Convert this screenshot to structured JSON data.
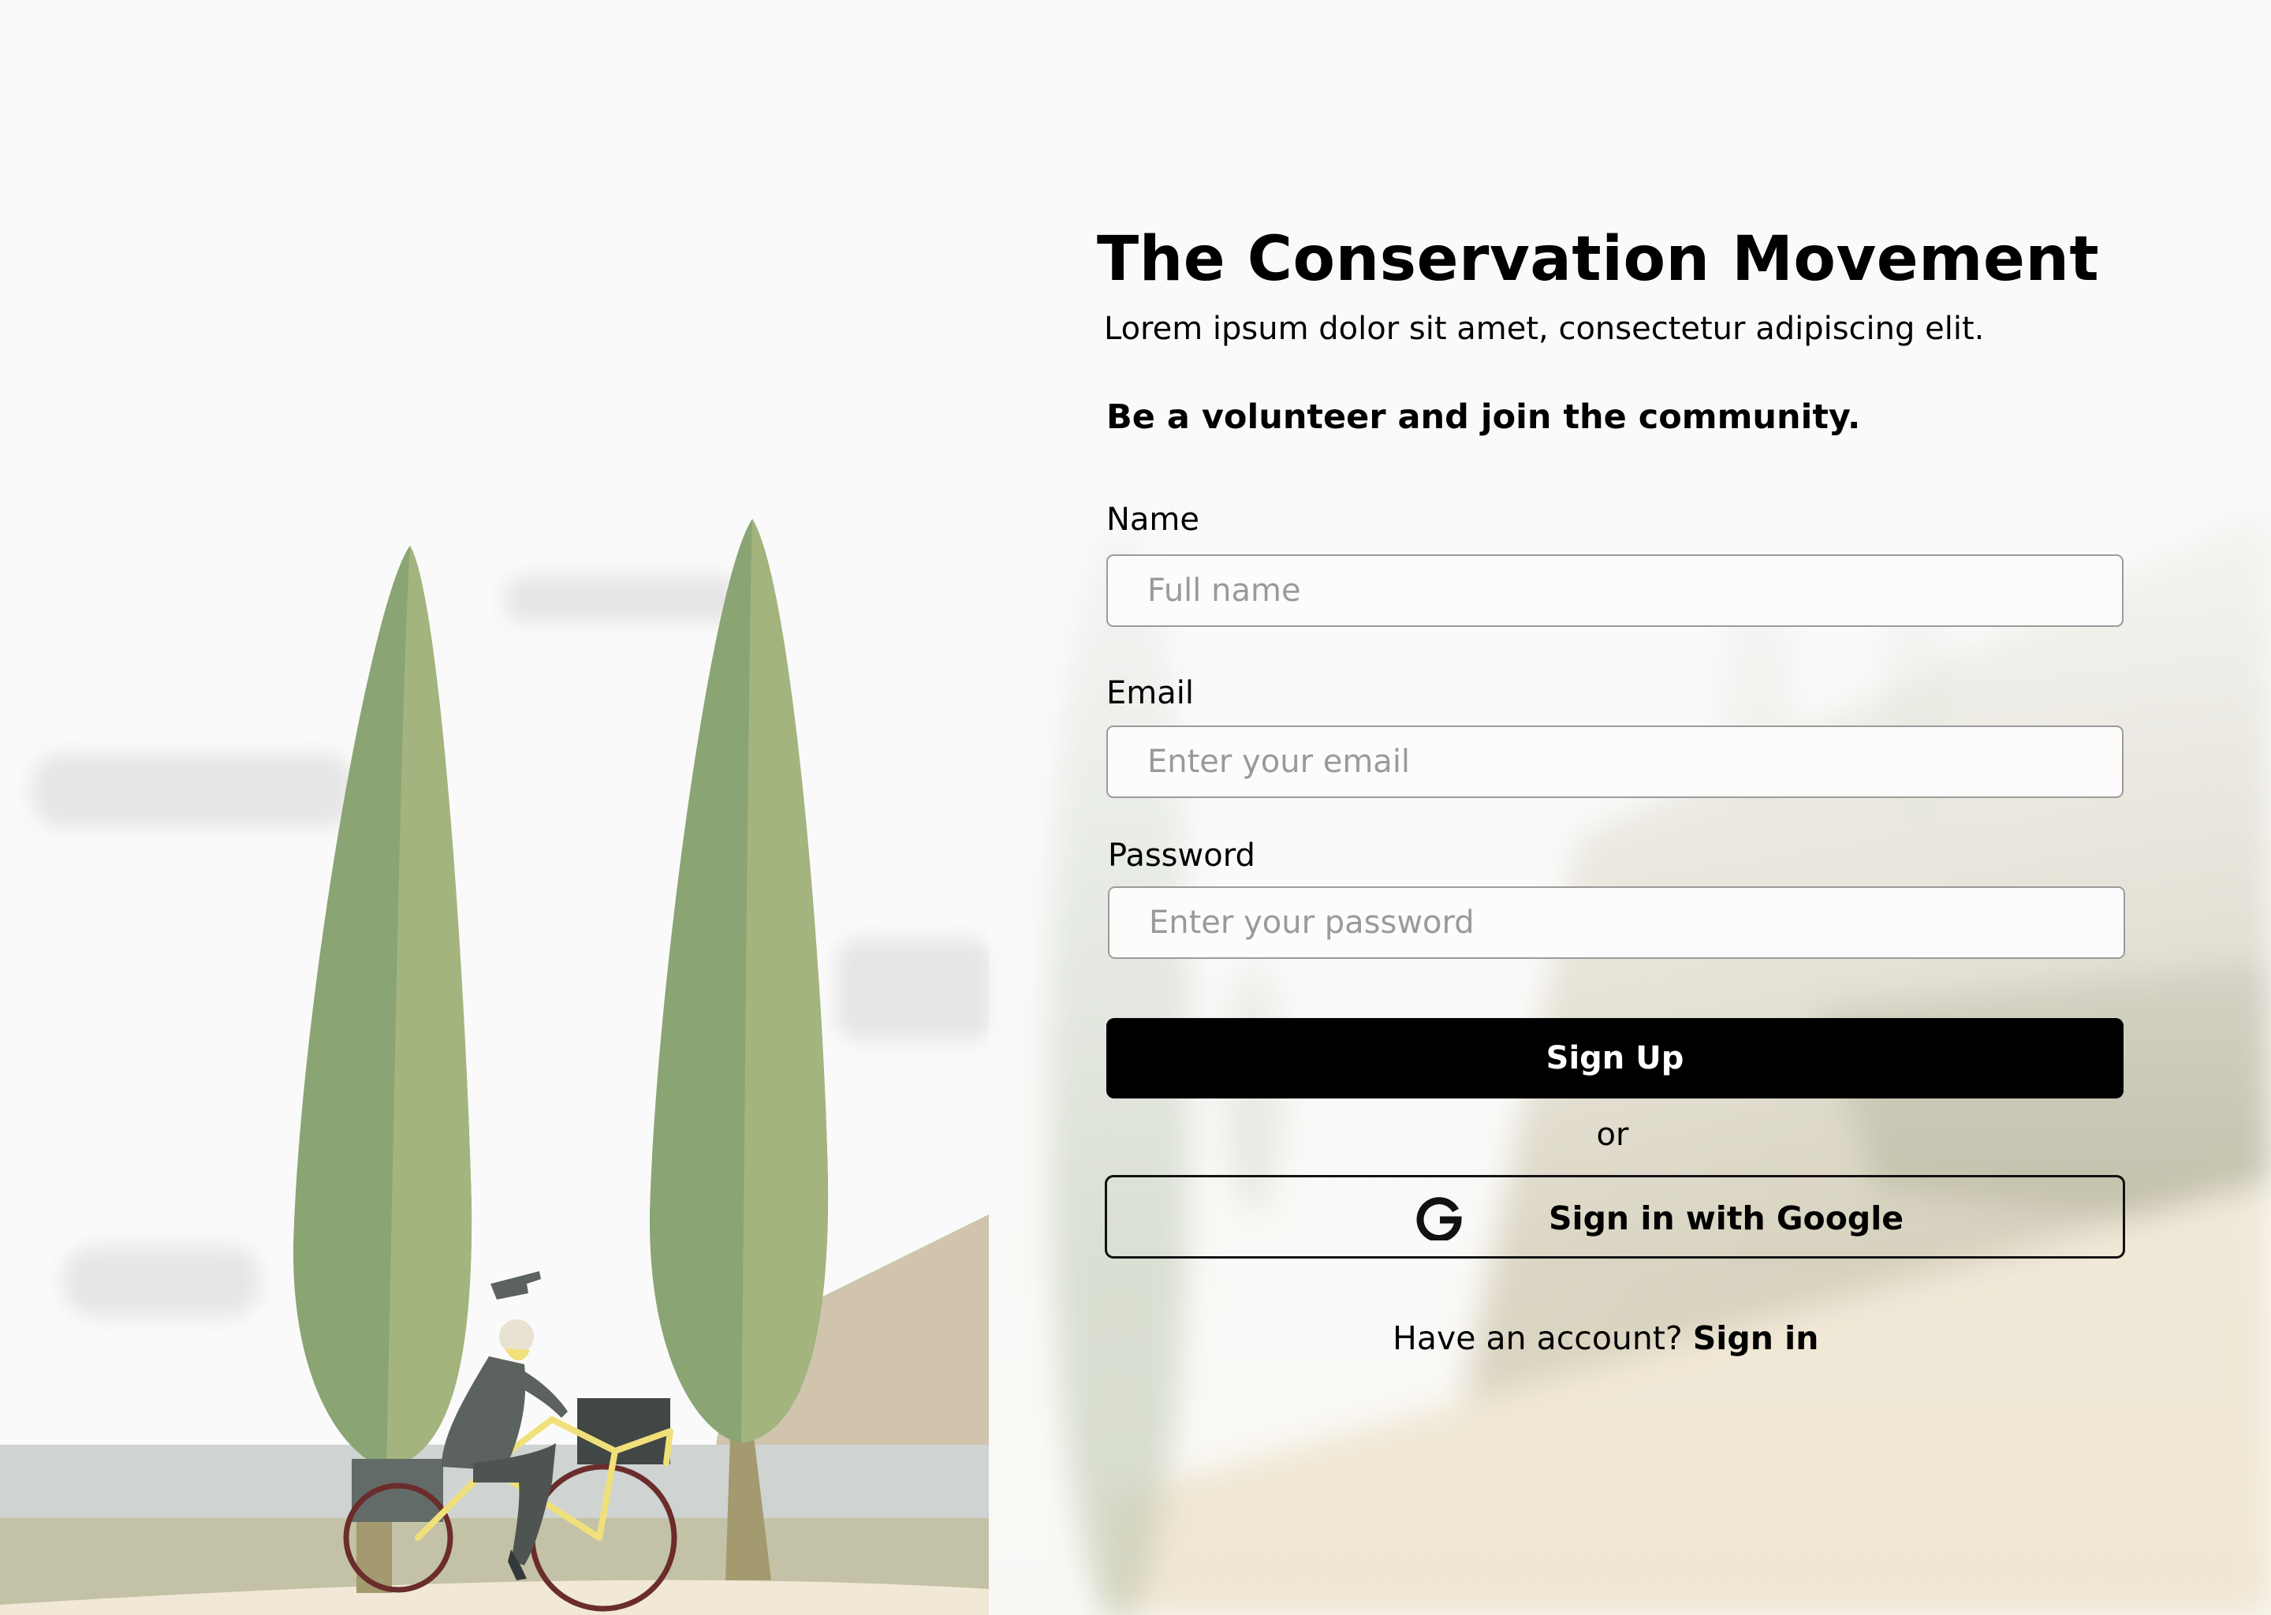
{
  "header": {
    "title": "The Conservation Movement",
    "subtitle": "Lorem ipsum dolor sit amet, consectetur adipiscing elit.",
    "tagline": "Be a volunteer and join the community."
  },
  "form": {
    "name": {
      "label": "Name",
      "placeholder": "Full name",
      "value": ""
    },
    "email": {
      "label": "Email",
      "placeholder": "Enter your email",
      "value": ""
    },
    "password": {
      "label": "Password",
      "placeholder": "Enter your password",
      "value": ""
    },
    "signup_label": "Sign Up",
    "divider_text": "or",
    "google_label": "Sign in with Google",
    "google_icon": "google-g-icon",
    "account_prompt": "Have an account?",
    "signin_label": "Sign in"
  },
  "illustration": {
    "subject": "cyclist-between-cypress-trees",
    "colors": {
      "tree_dark": "#8aa473",
      "tree_light": "#a3b47e",
      "hill": "#d0c4ad",
      "road": "#cfd3d2",
      "ground": "#c4c2a6",
      "sand": "#f1e8d6",
      "bike_frame": "#f0e07a",
      "wheel": "#6b2c2c",
      "rider": "#5c625e"
    }
  },
  "theme": {
    "primary": "#000000",
    "background": "#fafafa",
    "field_border": "#9b9b9b"
  }
}
